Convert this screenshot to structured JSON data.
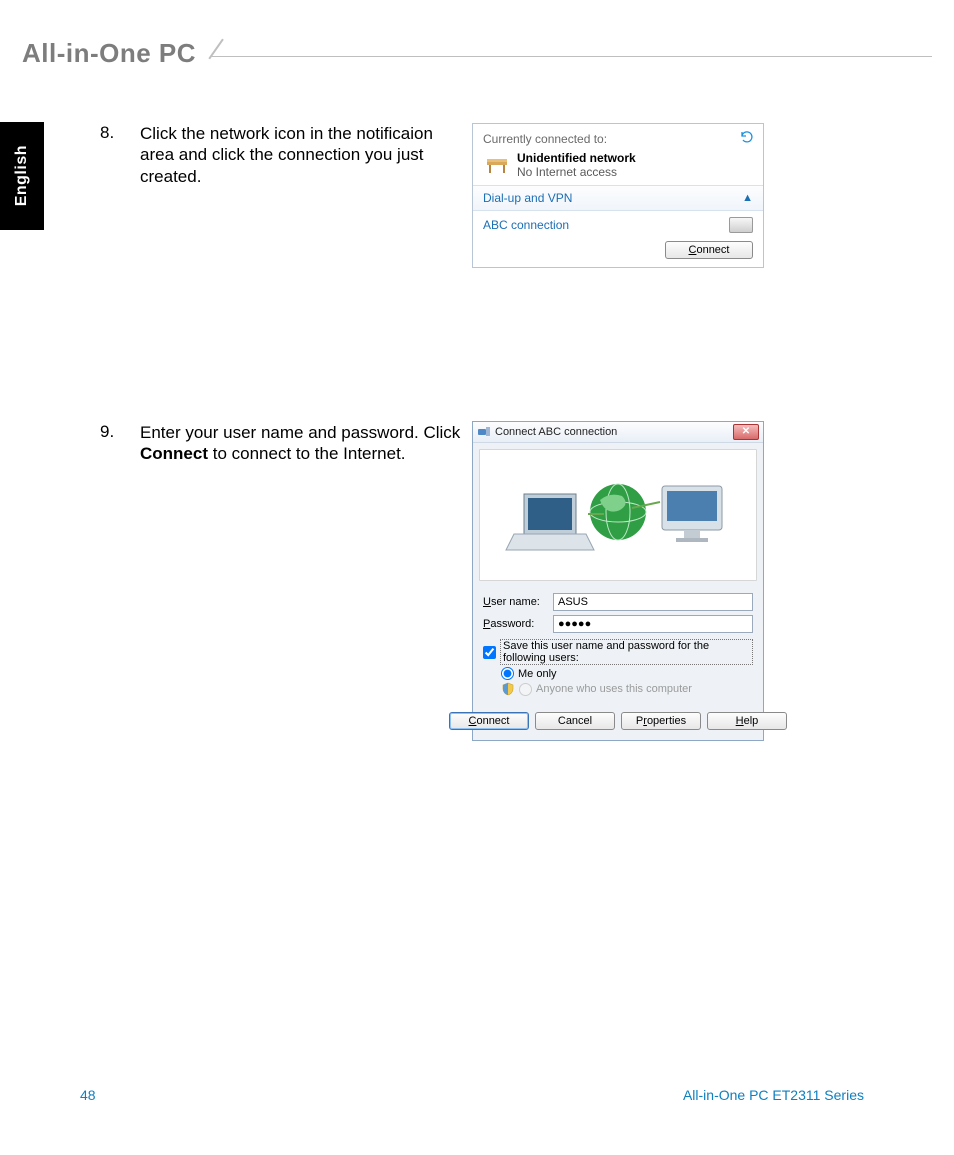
{
  "header": {
    "title": "All-in-One PC"
  },
  "sidetab": {
    "label": "English"
  },
  "step8": {
    "num": "8.",
    "text": "Click the network icon in the notificaion area and click the connection you just created."
  },
  "step9": {
    "num": "9.",
    "text_a": "Enter your user name and password. Click ",
    "bold": "Connect",
    "text_b": " to connect to the Internet."
  },
  "flyout": {
    "connected_label": "Currently connected to:",
    "net_name": "Unidentified network",
    "net_sub": "No Internet access",
    "section": "Dial-up and VPN",
    "conn_name": "ABC connection",
    "connect_btn_u": "C",
    "connect_btn_rest": "onnect"
  },
  "dialog": {
    "title": "Connect ABC connection",
    "user_label_u": "U",
    "user_label_rest": "ser name:",
    "user_value": "ASUS",
    "pass_label_u": "P",
    "pass_label_rest": "assword:",
    "pass_value": "●●●●●",
    "save_u": "S",
    "save_rest": "ave this user name and password for the following users:",
    "me_only": "Me o",
    "me_only_u": "n",
    "me_only_rest": "ly",
    "anyone_u": "A",
    "anyone_rest": "nyone who uses this computer",
    "btn_connect_u": "C",
    "btn_connect_rest": "onnect",
    "btn_cancel": "Cancel",
    "btn_props_a": "P",
    "btn_props_u": "r",
    "btn_props_b": "operties",
    "btn_help_u": "H",
    "btn_help_rest": "elp"
  },
  "footer": {
    "page": "48",
    "series": "All-in-One PC ET2311 Series"
  }
}
